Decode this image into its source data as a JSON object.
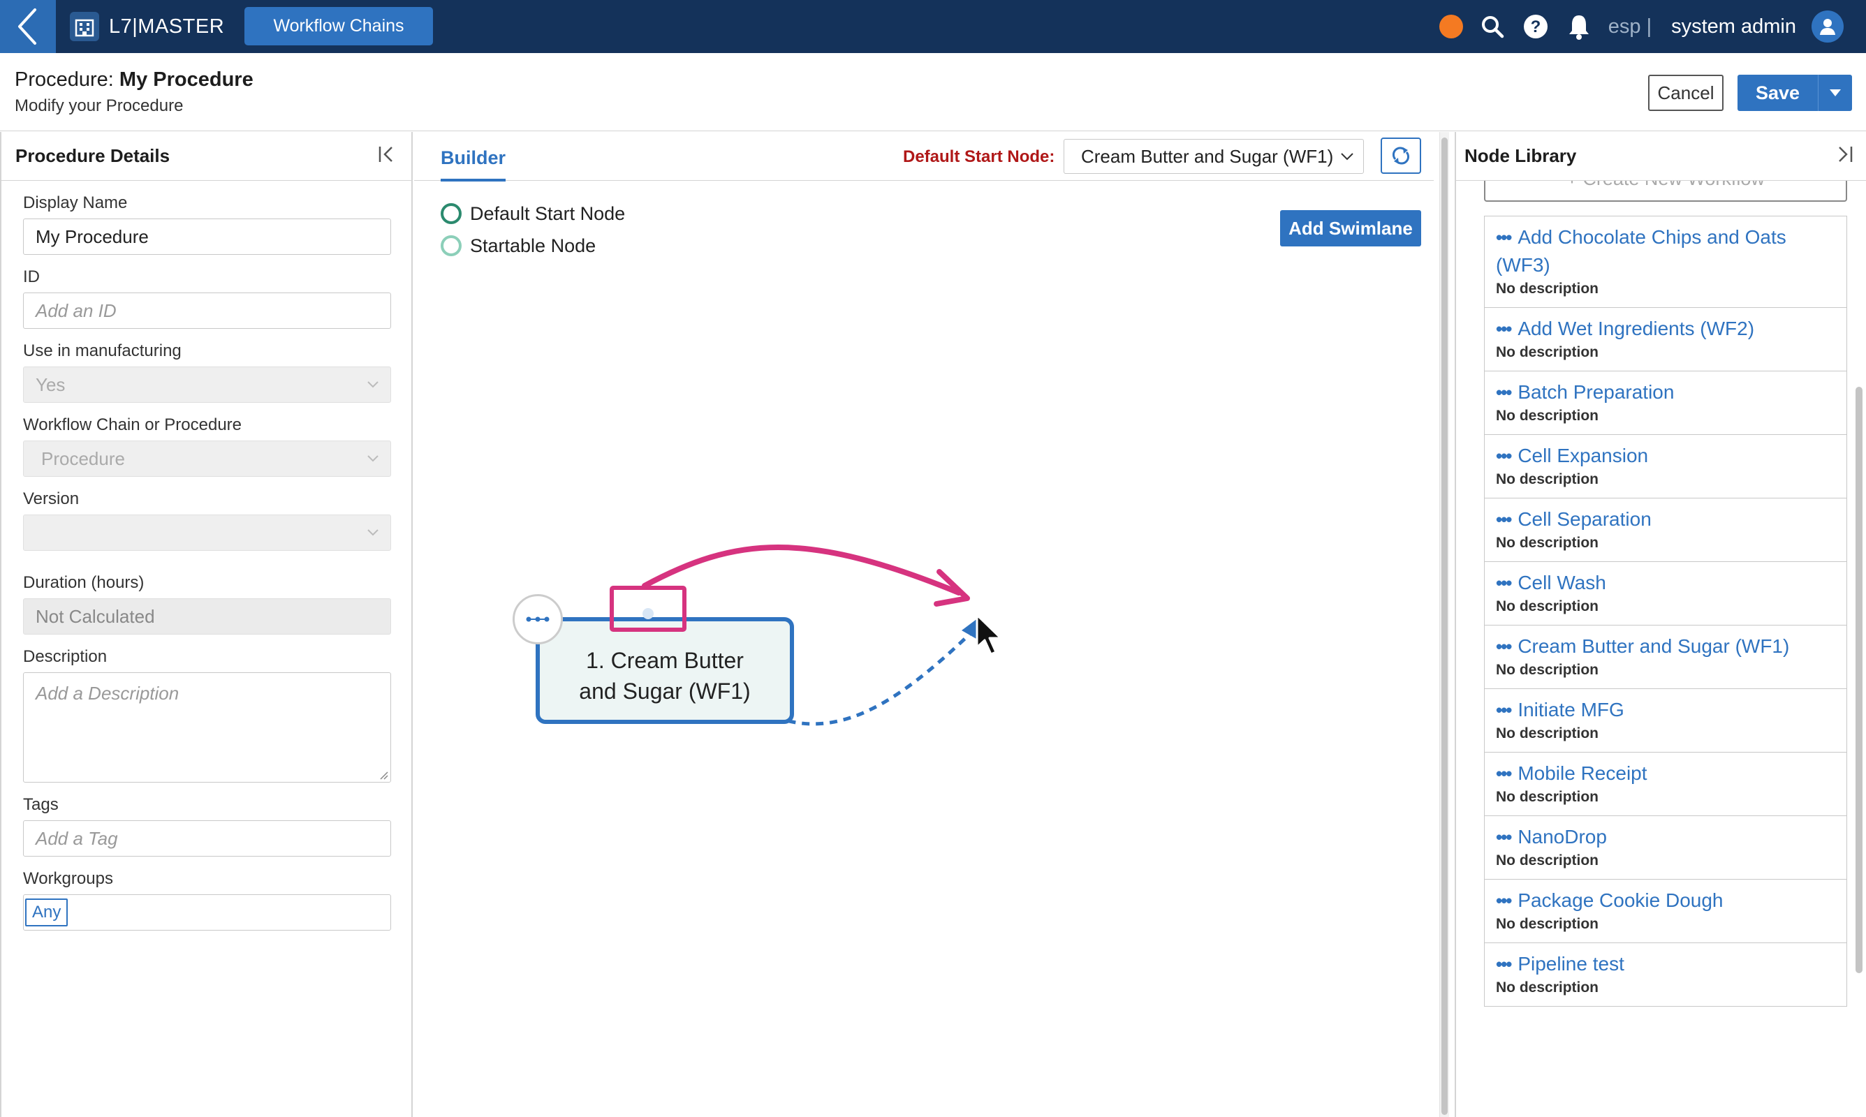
{
  "nav": {
    "brand": "L7|MASTER",
    "active_tab": "Workflow Chains",
    "lang": "esp |",
    "user": "system admin"
  },
  "title": {
    "prefix": "Procedure:",
    "name": "My Procedure",
    "subtitle": "Modify your Procedure",
    "cancel": "Cancel",
    "save": "Save"
  },
  "details": {
    "header": "Procedure Details",
    "display_name_label": "Display Name",
    "display_name_value": "My Procedure",
    "id_label": "ID",
    "id_placeholder": "Add an ID",
    "manufacturing_label": "Use in manufacturing",
    "manufacturing_value": "Yes",
    "chain_label": "Workflow Chain or Procedure",
    "chain_value": "Procedure",
    "version_label": "Version",
    "version_value": "",
    "duration_label": "Duration (hours)",
    "duration_value": "Not Calculated",
    "description_label": "Description",
    "description_placeholder": "Add a Description",
    "tags_label": "Tags",
    "tags_placeholder": "Add a Tag",
    "workgroups_label": "Workgroups",
    "workgroups_value": "Any"
  },
  "builder": {
    "tab": "Builder",
    "default_start_label": "Default Start Node:",
    "default_start_value": "Cream Butter and Sugar (WF1)",
    "legend_default": "Default Start Node",
    "legend_startable": "Startable Node",
    "add_swimlane": "Add Swimlane",
    "node_label_line1": "1. Cream Butter",
    "node_label_line2": "and Sugar (WF1)"
  },
  "library": {
    "header": "Node Library",
    "create_label": "+ Create New Workflow",
    "items": [
      {
        "title": "Add Chocolate Chips and Oats (WF3)",
        "desc": "No description"
      },
      {
        "title": "Add Wet Ingredients (WF2)",
        "desc": "No description"
      },
      {
        "title": "Batch Preparation",
        "desc": "No description"
      },
      {
        "title": "Cell Expansion",
        "desc": "No description"
      },
      {
        "title": "Cell Separation",
        "desc": "No description"
      },
      {
        "title": "Cell Wash",
        "desc": "No description"
      },
      {
        "title": "Cream Butter and Sugar (WF1)",
        "desc": "No description"
      },
      {
        "title": "Initiate MFG",
        "desc": "No description"
      },
      {
        "title": "Mobile Receipt",
        "desc": "No description"
      },
      {
        "title": "NanoDrop",
        "desc": "No description"
      },
      {
        "title": "Package Cookie Dough",
        "desc": "No description"
      },
      {
        "title": "Pipeline test",
        "desc": "No description"
      }
    ]
  },
  "colors": {
    "nav_bg": "#14325a",
    "accent": "#2f73c0",
    "annotation": "#d6337f",
    "status_dot": "#f47a22",
    "default_start_ring": "#2b8a6e",
    "startable_ring": "#8ccfb9"
  }
}
